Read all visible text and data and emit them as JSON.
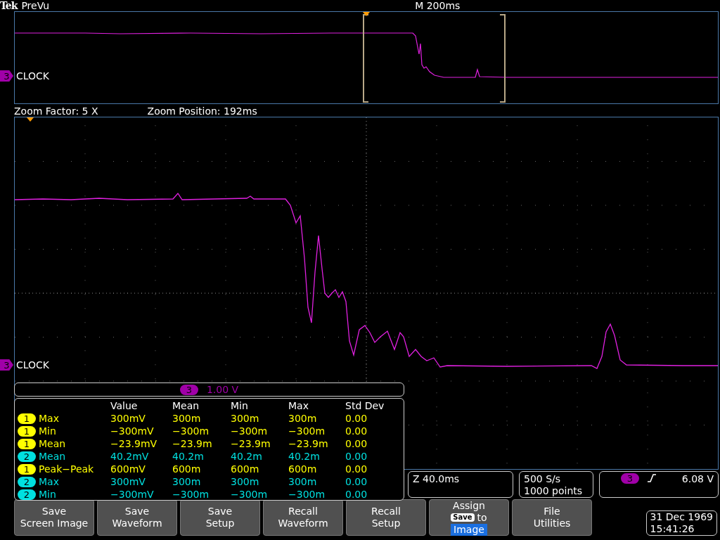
{
  "header": {
    "brand": "Tek",
    "mode": "PreVu",
    "timebase": "M 200ms"
  },
  "preview": {
    "channel": "3",
    "label": "CLOCK"
  },
  "zoom_info": {
    "factor": "Zoom Factor: 5 X",
    "position": "Zoom Position: 192ms"
  },
  "main": {
    "channel": "3",
    "label": "CLOCK"
  },
  "channel_readout": {
    "channel": "3",
    "scale": "1.00 V"
  },
  "measurements": {
    "columns": [
      "Value",
      "Mean",
      "Min",
      "Max",
      "Std Dev"
    ],
    "rows": [
      {
        "channel": "1",
        "color": "#ffff00",
        "name": "Max",
        "cells": [
          "300mV",
          "300m",
          "300m",
          "300m",
          "0.00"
        ]
      },
      {
        "channel": "1",
        "color": "#ffff00",
        "name": "Min",
        "cells": [
          "−300mV",
          "−300m",
          "−300m",
          "−300m",
          "0.00"
        ]
      },
      {
        "channel": "1",
        "color": "#ffff00",
        "name": "Mean",
        "cells": [
          "−23.9mV",
          "−23.9m",
          "−23.9m",
          "−23.9m",
          "0.00"
        ]
      },
      {
        "channel": "2",
        "color": "#00e0e0",
        "name": "Mean",
        "cells": [
          "40.2mV",
          "40.2m",
          "40.2m",
          "40.2m",
          "0.00"
        ]
      },
      {
        "channel": "1",
        "color": "#ffff00",
        "name": "Peak−Peak",
        "cells": [
          "600mV",
          "600m",
          "600m",
          "600m",
          "0.00"
        ]
      },
      {
        "channel": "2",
        "color": "#00e0e0",
        "name": "Max",
        "cells": [
          "300mV",
          "300m",
          "300m",
          "300m",
          "0.00"
        ]
      },
      {
        "channel": "2",
        "color": "#00e0e0",
        "name": "Min",
        "cells": [
          "−300mV",
          "−300m",
          "−300m",
          "−300m",
          "0.00"
        ]
      }
    ]
  },
  "zoom_time": "Z 40.0ms",
  "acquisition": [
    "500 S/s",
    "1000 points"
  ],
  "trigger": {
    "channel": "3",
    "rising_edge": true,
    "voltage": "6.08 V"
  },
  "softkeys": [
    {
      "kind": "plain",
      "lines": [
        "Save",
        "Screen Image"
      ]
    },
    {
      "kind": "plain",
      "lines": [
        "Save",
        "Waveform"
      ]
    },
    {
      "kind": "plain",
      "lines": [
        "Save",
        "Setup"
      ]
    },
    {
      "kind": "plain",
      "lines": [
        "Recall",
        "Waveform"
      ]
    },
    {
      "kind": "plain",
      "lines": [
        "Recall",
        "Setup"
      ]
    },
    {
      "kind": "assign",
      "lines": [
        "Assign"
      ],
      "key": "Save",
      "word": "to",
      "target": "Image"
    },
    {
      "kind": "plain",
      "lines": [
        "File",
        "Utilities"
      ]
    }
  ],
  "datetime": [
    "31 Dec 1969",
    "15:41:26"
  ]
}
